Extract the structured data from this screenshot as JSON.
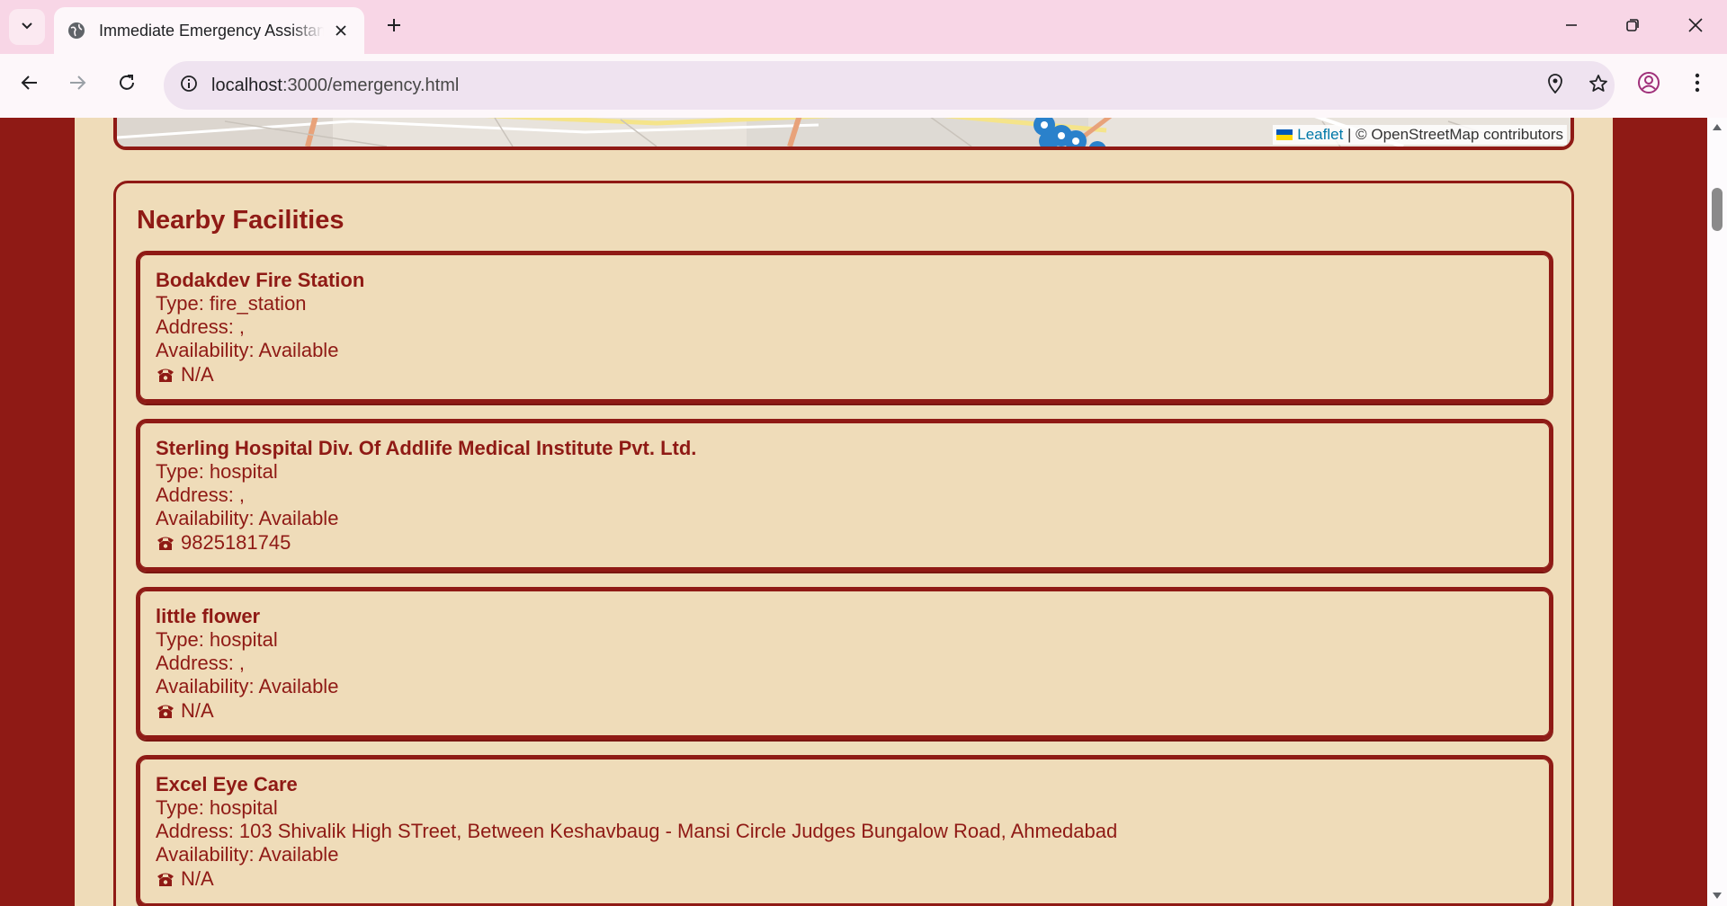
{
  "browser": {
    "tab_title": "Immediate Emergency Assistance",
    "url_host": "localhost",
    "url_path": ":3000/emergency.html"
  },
  "map": {
    "attribution_link": "Leaflet",
    "attribution_text": "| © OpenStreetMap contributors"
  },
  "facilities": {
    "title": "Nearby Facilities",
    "items": [
      {
        "name": "Bodakdev Fire Station",
        "type": "Type: fire_station",
        "address": "Address: ,",
        "availability": "Availability: Available",
        "phone": "N/A"
      },
      {
        "name": "Sterling Hospital Div. Of Addlife Medical Institute Pvt. Ltd.",
        "type": "Type: hospital",
        "address": "Address: ,",
        "availability": "Availability: Available",
        "phone": "9825181745"
      },
      {
        "name": "little flower",
        "type": "Type: hospital",
        "address": "Address: ,",
        "availability": "Availability: Available",
        "phone": "N/A"
      },
      {
        "name": "Excel Eye Care",
        "type": "Type: hospital",
        "address": "Address: 103 Shivalik High STreet, Between Keshavbaug - Mansi Circle Judges Bungalow Road, Ahmedabad",
        "availability": "Availability: Available",
        "phone": "N/A"
      }
    ]
  },
  "colors": {
    "primary": "#8f1a15",
    "background": "#efdcb9",
    "tabbar": "#f8d6e6"
  }
}
